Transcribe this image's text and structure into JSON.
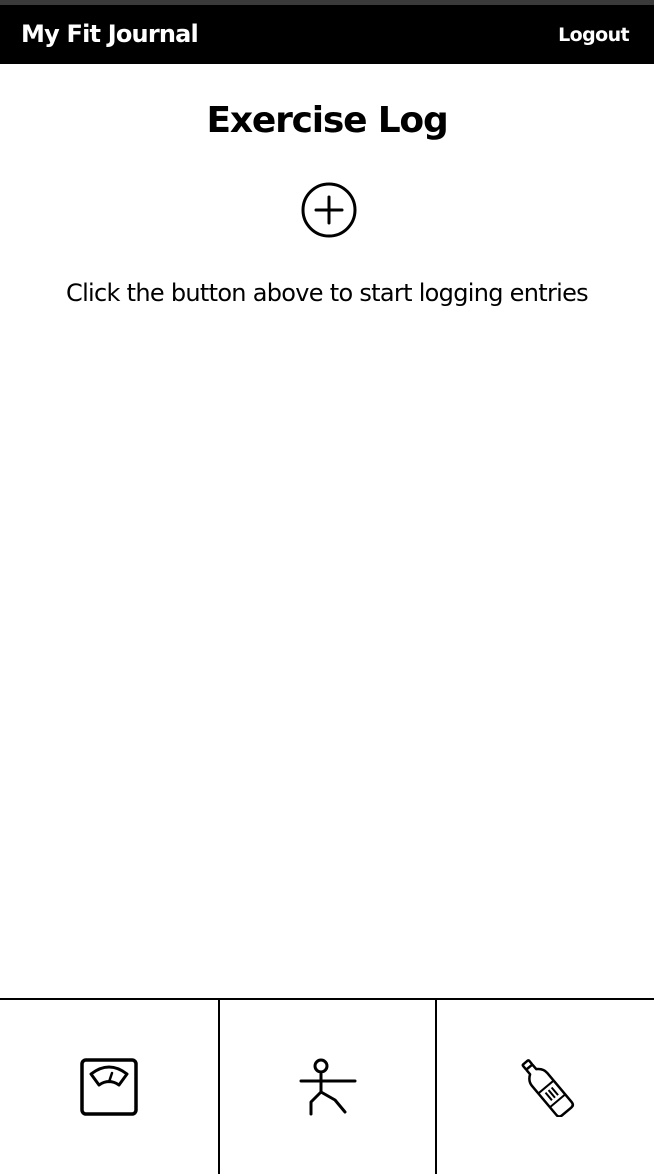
{
  "header": {
    "brand": "My Fit Journal",
    "logout_label": "Logout"
  },
  "main": {
    "title": "Exercise Log",
    "add_icon": "plus-circle-icon",
    "hint": "Click the button above to start logging entries"
  },
  "bottom_nav": {
    "items": [
      {
        "icon": "scale-icon"
      },
      {
        "icon": "exercise-pose-icon"
      },
      {
        "icon": "water-bottle-icon"
      }
    ]
  },
  "colors": {
    "header_bg": "#000000",
    "header_text": "#ffffff",
    "page_bg": "#ffffff"
  }
}
